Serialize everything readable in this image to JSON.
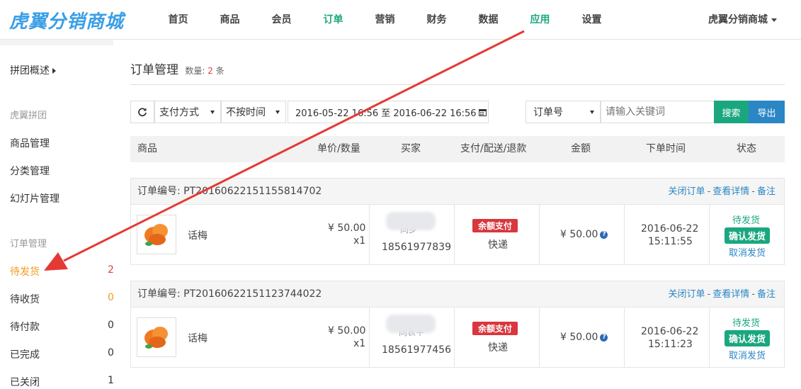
{
  "brand": {
    "logo_text": "虎翼分销商城",
    "shop_name": "虎翼分销商城"
  },
  "nav": [
    {
      "label": "首页"
    },
    {
      "label": "商品"
    },
    {
      "label": "会员"
    },
    {
      "label": "订单"
    },
    {
      "label": "营销"
    },
    {
      "label": "财务"
    },
    {
      "label": "数据"
    },
    {
      "label": "应用"
    },
    {
      "label": "设置"
    }
  ],
  "sidebar": {
    "overview": "拼团概述",
    "group1": "虎翼拼团",
    "items1": [
      "商品管理",
      "分类管理",
      "幻灯片管理"
    ],
    "group2": "订单管理",
    "order_items": [
      {
        "label": "待发货",
        "count": "2"
      },
      {
        "label": "待收货",
        "count": "0"
      },
      {
        "label": "待付款",
        "count": "0"
      },
      {
        "label": "已完成",
        "count": "0"
      },
      {
        "label": "已关闭",
        "count": "1"
      }
    ]
  },
  "page": {
    "title": "订单管理",
    "count_label": "数量:",
    "count": "2",
    "count_unit": "条"
  },
  "filters": {
    "payment": "支付方式",
    "time": "不按时间",
    "date_range": "2016-05-22 16:56 至 2016-06-22 16:56",
    "field": "订单号",
    "keyword_placeholder": "请输入关键词",
    "search": "搜索",
    "export": "导出"
  },
  "columns": [
    "商品",
    "单价/数量",
    "买家",
    "支付/配送/退款",
    "金额",
    "下单时间",
    "状态"
  ],
  "order_actions": {
    "close": "关闭订单",
    "detail": "查看详情",
    "note": "备注",
    "sep": "-"
  },
  "orders": [
    {
      "no": "订单编号: PT20160622151155814702",
      "product": "话梅",
      "price": "¥ 50.00",
      "qty": "x1",
      "buyer_name": "同步",
      "buyer_phone": "18561977839",
      "pay_badge": "余额支付",
      "delivery": "快递",
      "amount": "¥ 50.00",
      "date": "2016-06-22",
      "time": "15:11:55",
      "status": "待发货",
      "confirm": "确认发货",
      "cancel": "取消发货"
    },
    {
      "no": "订单编号: PT20160622151123744022",
      "product": "话梅",
      "price": "¥ 50.00",
      "qty": "x1",
      "buyer_name": "同表平",
      "buyer_phone": "18561977456",
      "pay_badge": "余额支付",
      "delivery": "快递",
      "amount": "¥ 50.00",
      "date": "2016-06-22",
      "time": "15:11:23",
      "status": "待发货",
      "confirm": "确认发货",
      "cancel": "取消发货"
    }
  ],
  "colors": {
    "accent_green": "#1aa77f",
    "link_blue": "#2b86c5",
    "badge_red": "#d9363e",
    "active_orange": "#f39a1e",
    "annotation_red": "#e53935"
  }
}
